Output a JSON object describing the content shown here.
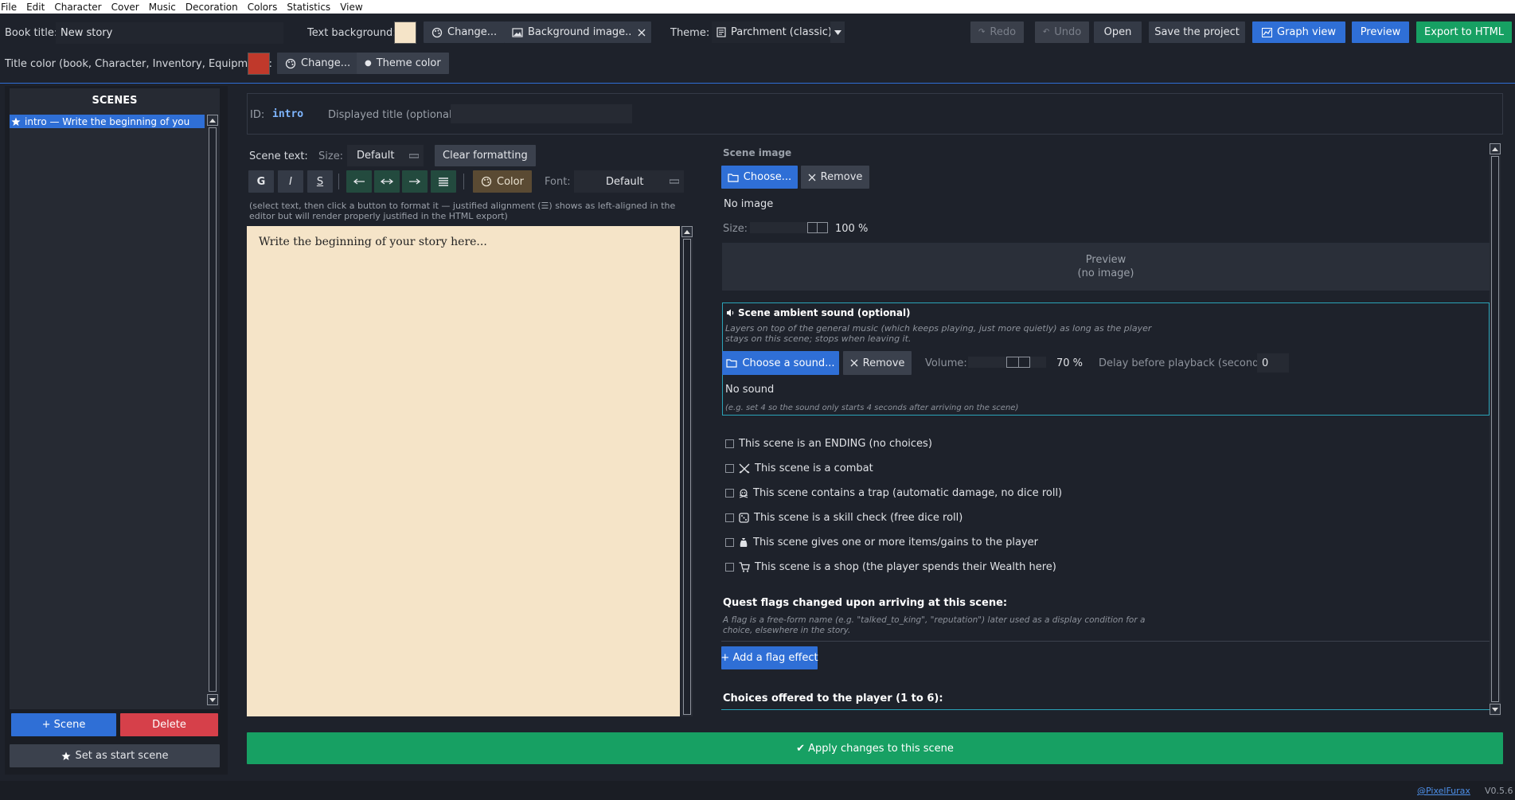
{
  "menu": [
    "File",
    "Edit",
    "Character",
    "Cover",
    "Music",
    "Decoration",
    "Colors",
    "Statistics",
    "View"
  ],
  "toolbar1": {
    "book_title_label": "Book title:",
    "book_title_value": "New story",
    "text_bg_label": "Text background:",
    "text_bg_color": "#f5e4c8",
    "change_label": "Change...",
    "bg_image_label": "Background image...",
    "theme_label": "Theme:",
    "theme_value": "Parchment (classic)",
    "redo": "Redo",
    "undo": "Undo",
    "open": "Open",
    "save": "Save the project",
    "graph": "Graph view",
    "preview": "Preview",
    "export": "Export to HTML"
  },
  "toolbar2": {
    "title_color_label": "Title color (book, Character, Inventory, Equipment):",
    "title_color": "#c0392b",
    "change_label": "Change...",
    "theme_color": "Theme color"
  },
  "scenes": {
    "header": "SCENES",
    "items": [
      "intro — Write the beginning of you"
    ],
    "add": "+ Scene",
    "delete": "Delete",
    "set_start": "Set as start scene"
  },
  "scene": {
    "id_label": "ID:",
    "id_value": "intro",
    "displayed_title_label": "Displayed title (optional):",
    "text_label": "Scene text:",
    "size_label": "Size:",
    "size_value": "Default",
    "clear": "Clear formatting",
    "bold": "G",
    "italic": "I",
    "strike": "S",
    "color": "Color",
    "font_label": "Font:",
    "font_value": "Default",
    "hint": "(select text, then click a button to format it — justified alignment (☰) shows as left-aligned in the editor but will render properly justified in the HTML export)",
    "body_text": "Write the beginning of your story here..."
  },
  "image": {
    "title": "Scene image",
    "choose": "Choose...",
    "remove": "Remove",
    "status": "No image",
    "size_label": "Size:",
    "size_value": "100 %",
    "size_fraction": 1.0,
    "preview_line1": "Preview",
    "preview_line2": "(no image)"
  },
  "sound": {
    "title": "Scene ambient sound (optional)",
    "desc": "Layers on top of the general music (which keeps playing, just more quietly) as long as the player stays on this scene; stops when leaving it.",
    "choose": "Choose a sound...",
    "remove": "Remove",
    "volume_label": "Volume:",
    "volume_value": "70 %",
    "volume_fraction": 0.7,
    "delay_label": "Delay before playback (seconds):",
    "delay_value": "0",
    "status": "No sound",
    "example": "(e.g. set 4 so the sound only starts 4 seconds after arriving on the scene)"
  },
  "checks": [
    "This scene is an ENDING (no choices)",
    "This scene is a combat",
    "This scene contains a trap (automatic damage, no dice roll)",
    "This scene is a skill check (free dice roll)",
    "This scene gives one or more items/gains to the player",
    "This scene is a shop (the player spends their Wealth here)"
  ],
  "flags": {
    "title": "Quest flags changed upon arriving at this scene:",
    "desc": "A flag is a free-form name (e.g. \"talked_to_king\", \"reputation\") later used as a display condition for a choice, elsewhere in the story.",
    "add": "+ Add a flag effect"
  },
  "choices_title": "Choices offered to the player (1 to 6):",
  "apply": "✔ Apply changes to this scene",
  "footer": {
    "credit": "@PixelFurax",
    "version": "V0.5.6"
  }
}
